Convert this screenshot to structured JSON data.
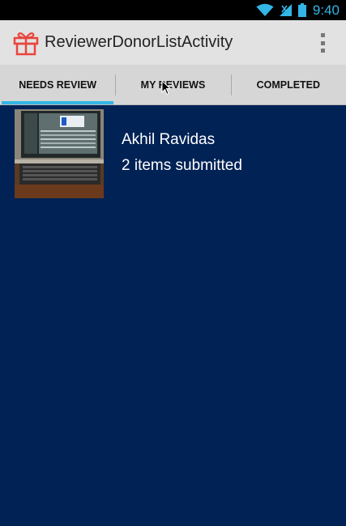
{
  "status_bar": {
    "time": "9:40",
    "icons": [
      "wifi-icon",
      "signal-icon",
      "battery-icon"
    ]
  },
  "action_bar": {
    "title": "ReviewerDonorListActivity",
    "app_icon": "gift-icon",
    "overflow_icon": "overflow-menu-icon"
  },
  "tabs": [
    {
      "label": "NEEDS REVIEW",
      "active": true
    },
    {
      "label": "MY REVIEWS",
      "active": false
    },
    {
      "label": "COMPLETED",
      "active": false
    }
  ],
  "donors": [
    {
      "name": "Akhil Ravidas",
      "subtitle": "2 items submitted",
      "thumbnail": "laptop-photo"
    }
  ],
  "colors": {
    "background": "#002255",
    "accent": "#33b5e5",
    "action_bar": "#e2e2e2",
    "tab_bar": "#d6d6d6",
    "app_icon": "#e8453c"
  }
}
